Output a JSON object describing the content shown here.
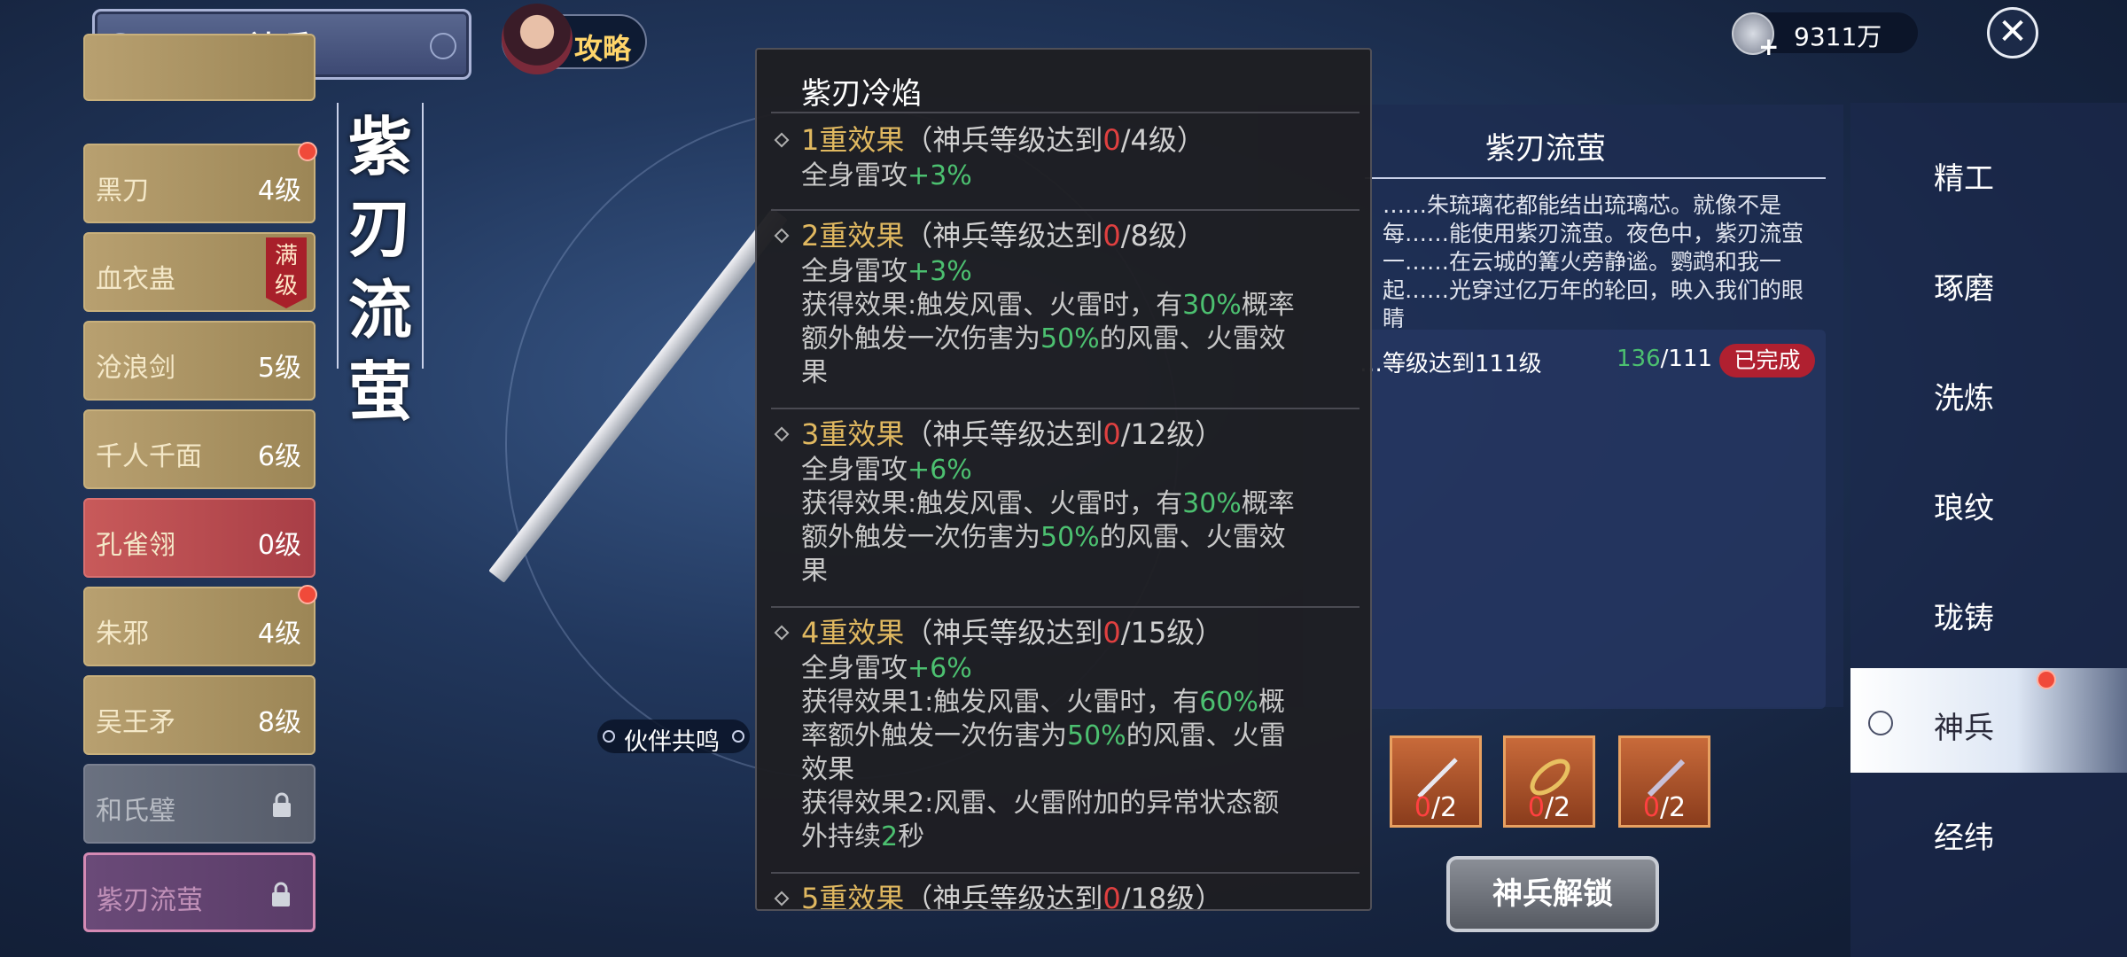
{
  "header": {
    "title": "神兵",
    "guide_label": "攻略",
    "currency_value": "9311万",
    "coin_plus": "+",
    "close_symbol": "✕"
  },
  "weapon_list": [
    {
      "name": "",
      "level": ""
    },
    {
      "name": "黑刀",
      "level": "4级",
      "dot": true
    },
    {
      "name": "血衣蛊",
      "level": "",
      "badge": "满级"
    },
    {
      "name": "沧浪剑",
      "level": "5级"
    },
    {
      "name": "千人千面",
      "level": "6级"
    },
    {
      "name": "孔雀翎",
      "level": "0级",
      "style": "red"
    },
    {
      "name": "朱邪",
      "level": "4级",
      "dot": true
    },
    {
      "name": "吴王矛",
      "level": "8级"
    },
    {
      "name": "和氏璧",
      "level": "",
      "locked": true,
      "style": "grey"
    },
    {
      "name": "紫刃流萤",
      "level": "",
      "locked": true,
      "style": "sel"
    }
  ],
  "weapon_name_vertical": "紫刃流萤",
  "resonance_label": "伙伴共鸣",
  "info": {
    "title": "紫刃流萤",
    "desc": "……朱琉璃花都能结出琉璃芯。就像不是每……能使用紫刃流萤。夜色中，紫刃流萤一……在云城的篝火旁静谧。鹦鹉和我一起……光穿过亿万年的轮回，映入我们的眼睛",
    "cond_text": "…等级达到111级",
    "cond_current": "136",
    "cond_total": "/111",
    "cond_status": "已完成"
  },
  "materials": [
    {
      "have": "0",
      "need": "/2"
    },
    {
      "have": "0",
      "need": "/2"
    },
    {
      "have": "0",
      "need": "/2"
    }
  ],
  "unlock_label": "神兵解锁",
  "nav": [
    {
      "label": "精工"
    },
    {
      "label": "琢磨"
    },
    {
      "label": "洗炼"
    },
    {
      "label": "琅纹"
    },
    {
      "label": "珑铸"
    },
    {
      "label": "神兵",
      "active": true,
      "dot": true
    },
    {
      "label": "经纬"
    }
  ],
  "popup": {
    "title": "紫刃冷焰",
    "effects": [
      {
        "tier": "1重效果",
        "cond_pre": "（神兵等级达到",
        "cond_cur": "0",
        "cond_post": "/4级）",
        "lines": [
          [
            "全身雷攻",
            {
              "g": "+3%"
            }
          ]
        ]
      },
      {
        "tier": "2重效果",
        "cond_pre": "（神兵等级达到",
        "cond_cur": "0",
        "cond_post": "/8级）",
        "lines": [
          [
            "全身雷攻",
            {
              "g": "+3%"
            }
          ],
          [
            "获得效果:触发风雷、火雷时，有",
            {
              "g": "30%"
            },
            "概率"
          ],
          [
            "额外触发一次伤害为",
            {
              "g": "50%"
            },
            "的风雷、火雷效"
          ],
          [
            "果"
          ]
        ]
      },
      {
        "tier": "3重效果",
        "cond_pre": "（神兵等级达到",
        "cond_cur": "0",
        "cond_post": "/12级）",
        "lines": [
          [
            "全身雷攻",
            {
              "g": "+6%"
            }
          ],
          [
            "获得效果:触发风雷、火雷时，有",
            {
              "g": "30%"
            },
            "概率"
          ],
          [
            "额外触发一次伤害为",
            {
              "g": "50%"
            },
            "的风雷、火雷效"
          ],
          [
            "果"
          ]
        ]
      },
      {
        "tier": "4重效果",
        "cond_pre": "（神兵等级达到",
        "cond_cur": "0",
        "cond_post": "/15级）",
        "lines": [
          [
            "全身雷攻",
            {
              "g": "+6%"
            }
          ],
          [
            "获得效果1:触发风雷、火雷时，有",
            {
              "g": "60%"
            },
            "概"
          ],
          [
            "率额外触发一次伤害为",
            {
              "g": "50%"
            },
            "的风雷、火雷"
          ],
          [
            "效果"
          ],
          [
            "获得效果2:风雷、火雷附加的异常状态额"
          ],
          [
            "外持续",
            {
              "g": "2"
            },
            "秒"
          ]
        ]
      },
      {
        "tier": "5重效果",
        "cond_pre": "（神兵等级达到",
        "cond_cur": "0",
        "cond_post": "/18级）",
        "lines": []
      }
    ]
  },
  "colors": {
    "accent_gold": "#e0b860",
    "green": "#4cc070",
    "red": "#e04040"
  }
}
